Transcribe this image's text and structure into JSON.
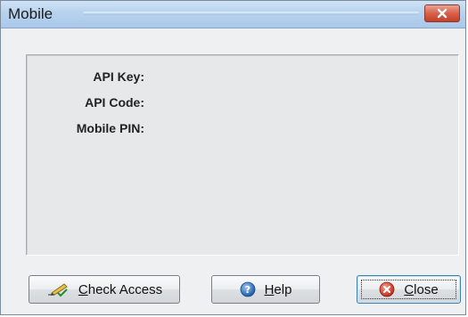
{
  "window": {
    "title": "Mobile"
  },
  "fields": [
    {
      "label": "API Key:"
    },
    {
      "label": "API Code:"
    },
    {
      "label": "Mobile PIN:"
    }
  ],
  "buttons": {
    "check_access": {
      "mnemonic": "C",
      "rest": "heck Access",
      "icon": "pen-check-icon"
    },
    "help": {
      "mnemonic": "H",
      "rest": "elp",
      "icon": "help-icon"
    },
    "close": {
      "mnemonic": "C",
      "rest": "lose",
      "icon": "close-circle-icon"
    }
  },
  "colors": {
    "title_bar": "#b7d2ee",
    "close_button": "#d9604a",
    "default_button_border": "#3c7fb1"
  }
}
